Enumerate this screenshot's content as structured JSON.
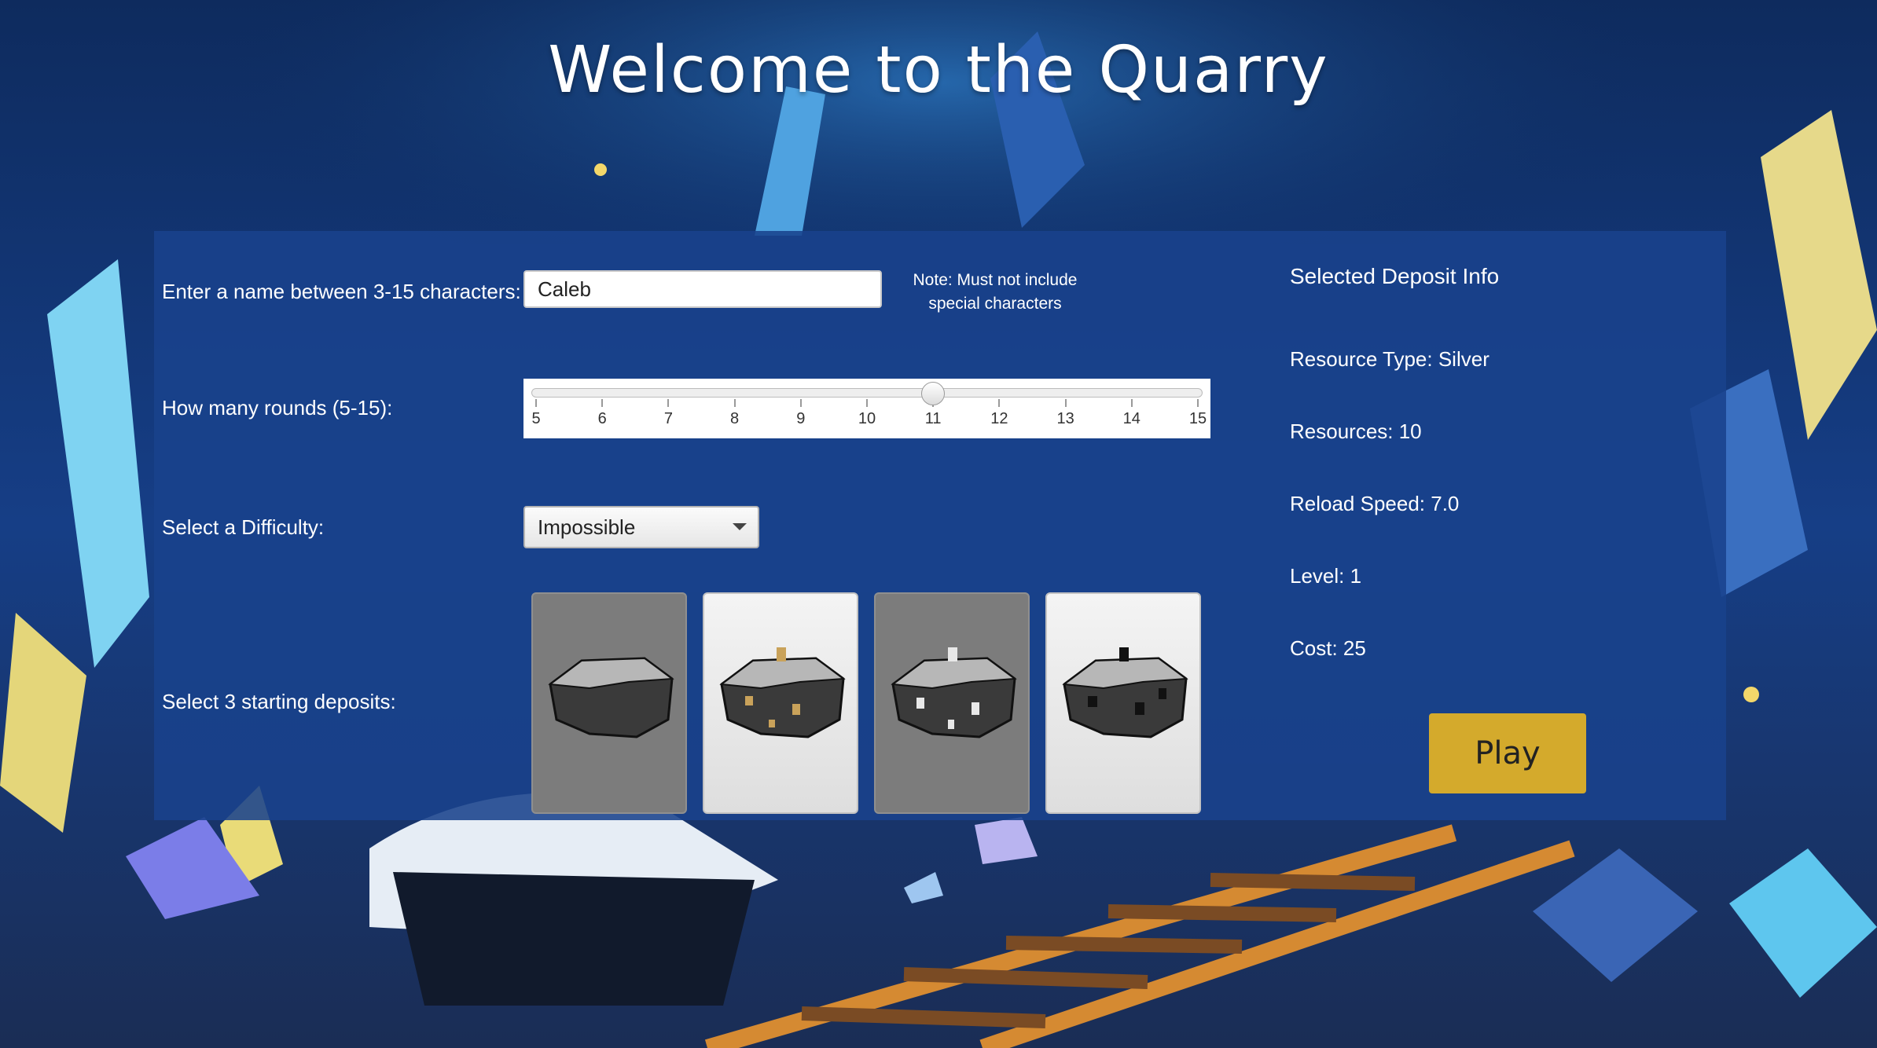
{
  "title": "Welcome to the Quarry",
  "form": {
    "name_label": "Enter a name between 3-15 characters:",
    "name_value": "Caleb",
    "name_note": "Note: Must not include special characters",
    "rounds_label": "How many rounds (5-15):",
    "rounds_min": 5,
    "rounds_max": 15,
    "rounds_value": 11,
    "rounds_ticks": [
      "5",
      "6",
      "7",
      "8",
      "9",
      "10",
      "11",
      "12",
      "13",
      "14",
      "15"
    ],
    "difficulty_label": "Select a Difficulty:",
    "difficulty_value": "Impossible",
    "deposits_label": "Select 3 starting deposits:",
    "deposits": [
      {
        "name": "plain-rock",
        "selected": true
      },
      {
        "name": "gold-rock",
        "selected": false
      },
      {
        "name": "silver-rock",
        "selected": true
      },
      {
        "name": "coal-rock",
        "selected": false
      }
    ]
  },
  "info": {
    "header": "Selected Deposit Info",
    "resource_type": "Resource Type: Silver",
    "resources": "Resources: 10",
    "reload_speed": "Reload Speed: 7.0",
    "level": "Level: 1",
    "cost": "Cost: 25"
  },
  "play_label": "Play",
  "colors": {
    "panel": "#19428c",
    "play_button": "#d4aa2c"
  }
}
